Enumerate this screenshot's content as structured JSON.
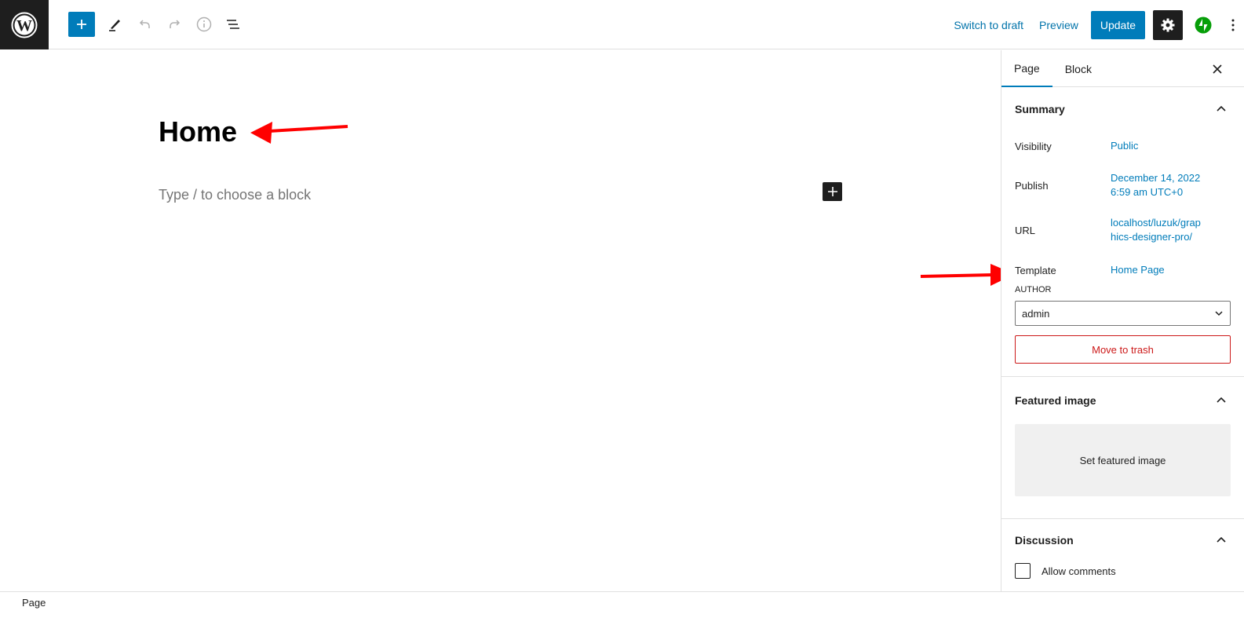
{
  "topbar": {
    "logo": "wordpress-logo",
    "tools": [
      {
        "name": "add-block",
        "icon": "plus-icon"
      },
      {
        "name": "tools",
        "icon": "pencil-icon"
      },
      {
        "name": "undo",
        "icon": "undo-icon"
      },
      {
        "name": "redo",
        "icon": "redo-icon"
      },
      {
        "name": "details",
        "icon": "info-icon"
      },
      {
        "name": "list-view",
        "icon": "list-view-icon"
      }
    ],
    "switch_to_draft": "Switch to draft",
    "preview": "Preview",
    "update": "Update",
    "settings_icon": "gear-icon",
    "jetpack_icon": "jetpack-icon",
    "more_icon": "more-vertical-icon"
  },
  "editor": {
    "title": "Home",
    "placeholder": "Type / to choose a block"
  },
  "sidebar": {
    "tabs": [
      {
        "label": "Page",
        "active": true
      },
      {
        "label": "Block",
        "active": false
      }
    ],
    "summary": {
      "heading": "Summary",
      "rows": [
        {
          "label": "Visibility",
          "value": "Public"
        },
        {
          "label": "Publish",
          "value_line1": "December 14, 2022",
          "value_line2": "6:59 am UTC+0"
        },
        {
          "label": "URL",
          "value_line1": "localhost/luzuk/grap",
          "value_line2": "hics-designer-pro/"
        },
        {
          "label": "Template",
          "value": "Home Page"
        }
      ],
      "author_label": "AUTHOR",
      "author_value": "admin",
      "trash": "Move to trash"
    },
    "featured_image": {
      "heading": "Featured image",
      "button": "Set featured image"
    },
    "discussion": {
      "heading": "Discussion",
      "allow_comments": "Allow comments"
    }
  },
  "footer": {
    "breadcrumb": "Page"
  },
  "annotations": {
    "arrow_color": "#ff0000"
  }
}
